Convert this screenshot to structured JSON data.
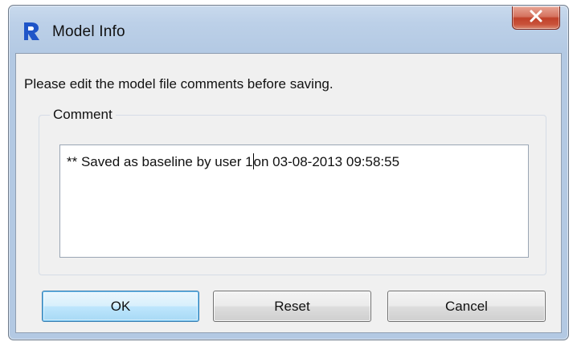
{
  "window": {
    "title": "Model Info",
    "close_symbol": "x"
  },
  "dialog": {
    "instruction": "Please edit the model file comments before saving.",
    "comment_group_label": "Comment",
    "comment": {
      "text_before_caret": "** Saved as baseline by user 1",
      "text_after_caret": "on 03-08-2013 09:58:55"
    }
  },
  "buttons": {
    "ok_label": "OK",
    "reset_label": "Reset",
    "cancel_label": "Cancel"
  },
  "icons": {
    "app": "riverware-logo-icon",
    "close": "close-icon"
  },
  "colors": {
    "app_icon_blue": "#1f55c8",
    "close_button_red": "#c9452d",
    "default_button_border": "#3c7fb1"
  }
}
